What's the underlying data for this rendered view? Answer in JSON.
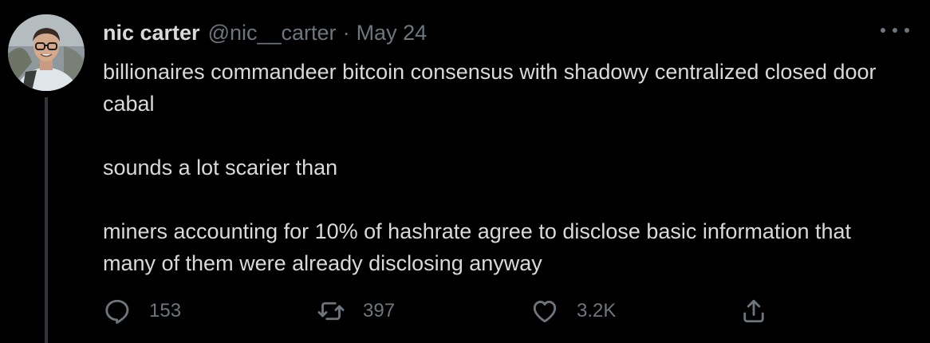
{
  "tweet": {
    "author": {
      "display_name": "nic carter",
      "handle": "@nic__carter"
    },
    "separator": "·",
    "date": "May 24",
    "paragraphs": [
      "billionaires commandeer bitcoin consensus with shadowy centralized closed door cabal",
      "sounds a lot scarier than",
      "miners accounting for 10% of hashrate agree to disclose basic information that many of them were already disclosing anyway"
    ],
    "actions": {
      "reply": {
        "icon": "reply-icon",
        "count": "153"
      },
      "retweet": {
        "icon": "retweet-icon",
        "count": "397"
      },
      "like": {
        "icon": "heart-icon",
        "count": "3.2K"
      },
      "share": {
        "icon": "share-icon"
      }
    },
    "more_icon": "more-options-icon"
  },
  "colors": {
    "background": "#000000",
    "primary_text": "#d9d9d9",
    "secondary_text": "#6e767d",
    "thread_line": "#333639"
  }
}
